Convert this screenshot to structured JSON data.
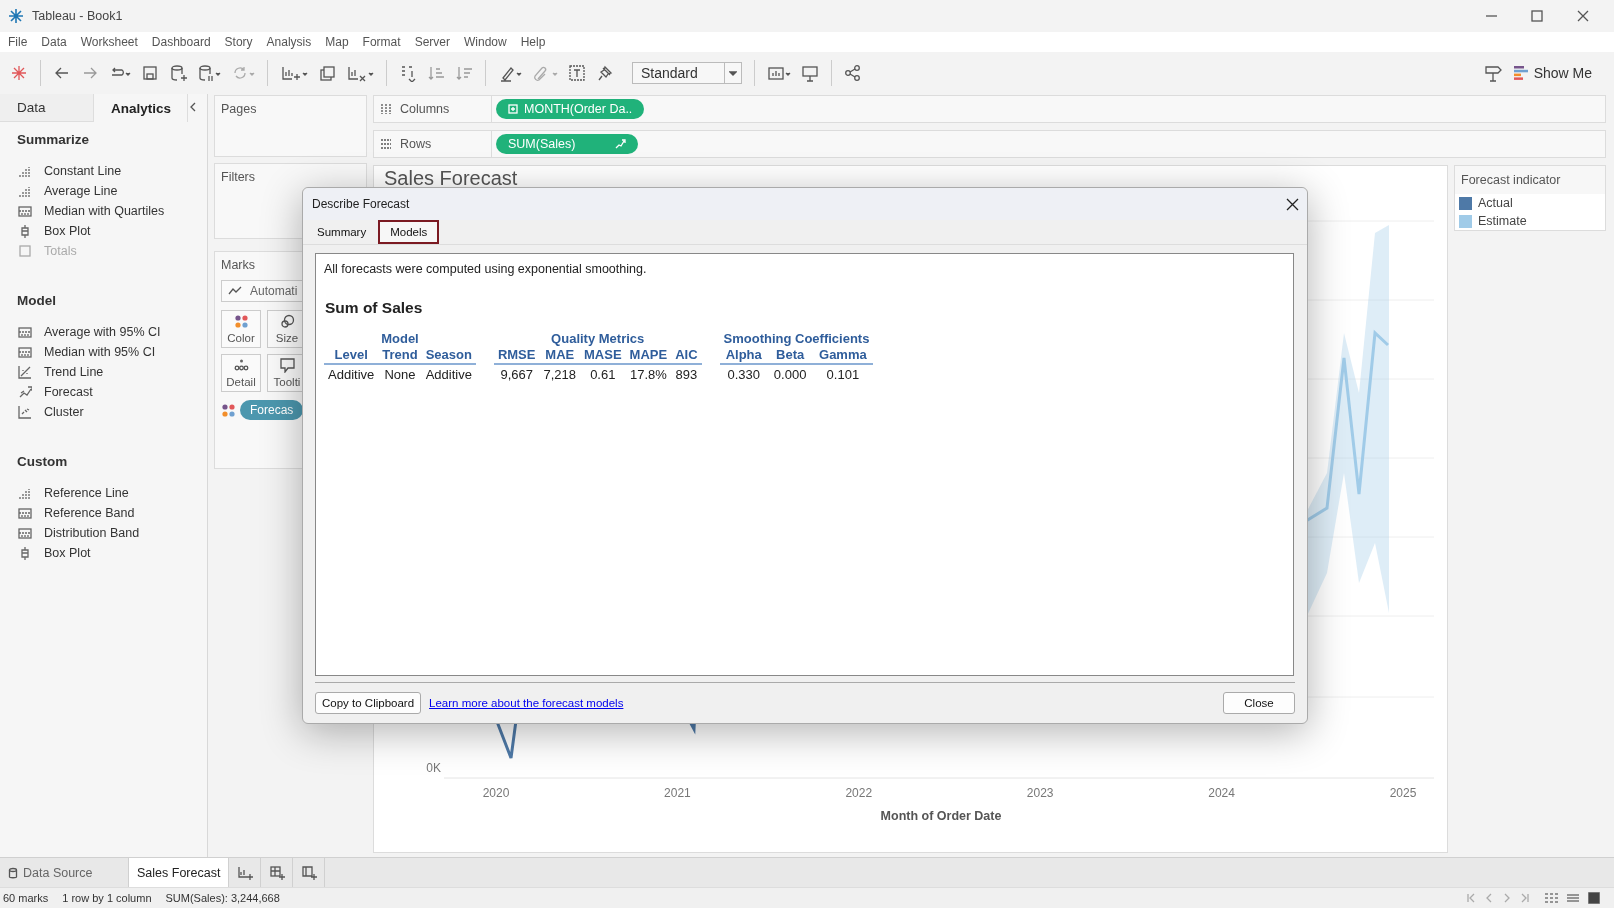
{
  "window": {
    "title": "Tableau - Book1"
  },
  "menu": [
    "File",
    "Data",
    "Worksheet",
    "Dashboard",
    "Story",
    "Analysis",
    "Map",
    "Format",
    "Server",
    "Window",
    "Help"
  ],
  "toolbar": {
    "fit": "Standard",
    "show_me": "Show Me"
  },
  "side_tabs": [
    {
      "label": "Data",
      "selected": false
    },
    {
      "label": "Analytics",
      "selected": true
    }
  ],
  "analytics": [
    {
      "heading": "Summarize",
      "items": [
        {
          "label": "Constant Line",
          "kind": "bars",
          "disabled": false
        },
        {
          "label": "Average Line",
          "kind": "bars",
          "disabled": false
        },
        {
          "label": "Median with Quartiles",
          "kind": "band",
          "disabled": false
        },
        {
          "label": "Box Plot",
          "kind": "box",
          "disabled": false
        },
        {
          "label": "Totals",
          "kind": "square",
          "disabled": true
        }
      ]
    },
    {
      "heading": "Model",
      "items": [
        {
          "label": "Average with 95% CI",
          "kind": "band",
          "disabled": false
        },
        {
          "label": "Median with 95% CI",
          "kind": "band",
          "disabled": false
        },
        {
          "label": "Trend Line",
          "kind": "trend",
          "disabled": false
        },
        {
          "label": "Forecast",
          "kind": "forecast",
          "disabled": false
        },
        {
          "label": "Cluster",
          "kind": "cluster",
          "disabled": false
        }
      ]
    },
    {
      "heading": "Custom",
      "items": [
        {
          "label": "Reference Line",
          "kind": "bars",
          "disabled": false
        },
        {
          "label": "Reference Band",
          "kind": "band",
          "disabled": false
        },
        {
          "label": "Distribution Band",
          "kind": "band",
          "disabled": false
        },
        {
          "label": "Box Plot",
          "kind": "box",
          "disabled": false
        }
      ]
    }
  ],
  "cards": {
    "pages": "Pages",
    "filters": "Filters",
    "marks": {
      "title": "Marks",
      "mark_type": "Automati",
      "buttons": [
        "Color",
        "Size",
        "Detail",
        "Toolti"
      ],
      "pill": "Forecas"
    }
  },
  "shelves": {
    "columns": {
      "label": "Columns",
      "pill": "MONTH(Order Da.."
    },
    "rows": {
      "label": "Rows",
      "pill": "SUM(Sales)"
    }
  },
  "view": {
    "title": "Sales Forecast",
    "y_tick": "0K",
    "x_ticks": [
      "2020",
      "2021",
      "2022",
      "2023",
      "2024",
      "2025"
    ],
    "x_title": "Month of Order Date"
  },
  "legend": {
    "title": "Forecast indicator",
    "items": [
      {
        "label": "Actual",
        "color": "#4e79a7"
      },
      {
        "label": "Estimate",
        "color": "#a0cbe8"
      }
    ]
  },
  "dialog": {
    "title": "Describe Forecast",
    "tabs": [
      {
        "label": "Summary",
        "selected": false
      },
      {
        "label": "Models",
        "selected": true
      }
    ],
    "intro": "All forecasts were computed using exponential smoothing.",
    "heading": "Sum of Sales",
    "groups": [
      {
        "label": "Model",
        "columns": [
          "Level",
          "Trend",
          "Season"
        ],
        "values": [
          "Additive",
          "None",
          "Additive"
        ]
      },
      {
        "label": "Quality Metrics",
        "columns": [
          "RMSE",
          "MAE",
          "MASE",
          "MAPE",
          "AIC"
        ],
        "values": [
          "9,667",
          "7,218",
          "0.61",
          "17.8%",
          "893"
        ]
      },
      {
        "label": "Smoothing Coefficients",
        "columns": [
          "Alpha",
          "Beta",
          "Gamma"
        ],
        "values": [
          "0.330",
          "0.000",
          "0.101"
        ]
      }
    ],
    "copy_button": "Copy to Clipboard",
    "link": "Learn more about the forecast models",
    "close_button": "Close"
  },
  "sheet_tabs": [
    {
      "label": "Data Source",
      "selected": false
    },
    {
      "label": "Sales Forecast",
      "selected": true
    }
  ],
  "status": [
    "60 marks",
    "1 row by 1 column",
    "SUM(Sales): 3,244,668"
  ]
}
